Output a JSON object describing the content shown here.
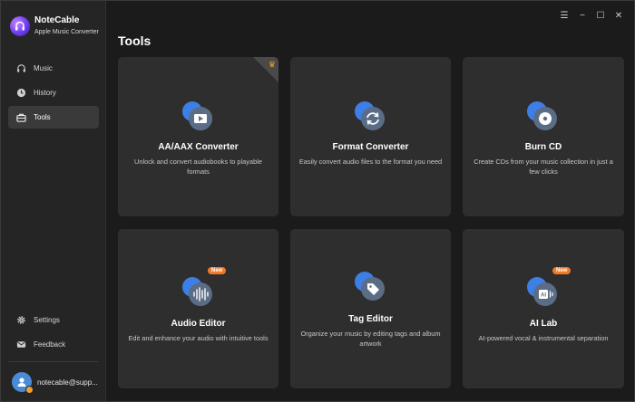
{
  "app": {
    "name": "NoteCable",
    "subtitle": "Apple Music Converter"
  },
  "sidebar": {
    "items": [
      {
        "label": "Music",
        "icon": "headphones-icon"
      },
      {
        "label": "History",
        "icon": "clock-icon"
      },
      {
        "label": "Tools",
        "icon": "toolbox-icon",
        "active": true
      }
    ],
    "bottom_items": [
      {
        "label": "Settings",
        "icon": "gear-icon"
      },
      {
        "label": "Feedback",
        "icon": "mail-icon"
      }
    ],
    "account_email": "notecable@supp..."
  },
  "window_controls": {
    "menu": "☰",
    "minimize": "−",
    "maximize": "☐",
    "close": "✕"
  },
  "page": {
    "title": "Tools"
  },
  "tools": [
    {
      "title": "AA/AAX Converter",
      "desc": "Unlock and convert audiobooks to playable formats",
      "icon": "play-video-icon",
      "premium": true
    },
    {
      "title": "Format Converter",
      "desc": "Easily convert audio files to the format you need",
      "icon": "convert-arrows-icon"
    },
    {
      "title": "Burn CD",
      "desc": "Create CDs from your music collection in just a few clicks",
      "icon": "disc-icon"
    },
    {
      "title": "Audio Editor",
      "desc": "Edit and enhance your audio with intuitive tools",
      "icon": "waveform-icon",
      "badge": "New"
    },
    {
      "title": "Tag Editor",
      "desc": "Organize your music by editing tags and album artwork",
      "icon": "tag-icon"
    },
    {
      "title": "AI Lab",
      "desc": "AI-powered vocal & instrumental separation",
      "icon": "ai-icon",
      "badge": "New"
    }
  ],
  "colors": {
    "accent": "#3d7fe6",
    "badge": "#f07a2a",
    "card_bg": "#2e2e2e",
    "sidebar_bg": "#252525",
    "page_bg": "#1b1b1b"
  }
}
